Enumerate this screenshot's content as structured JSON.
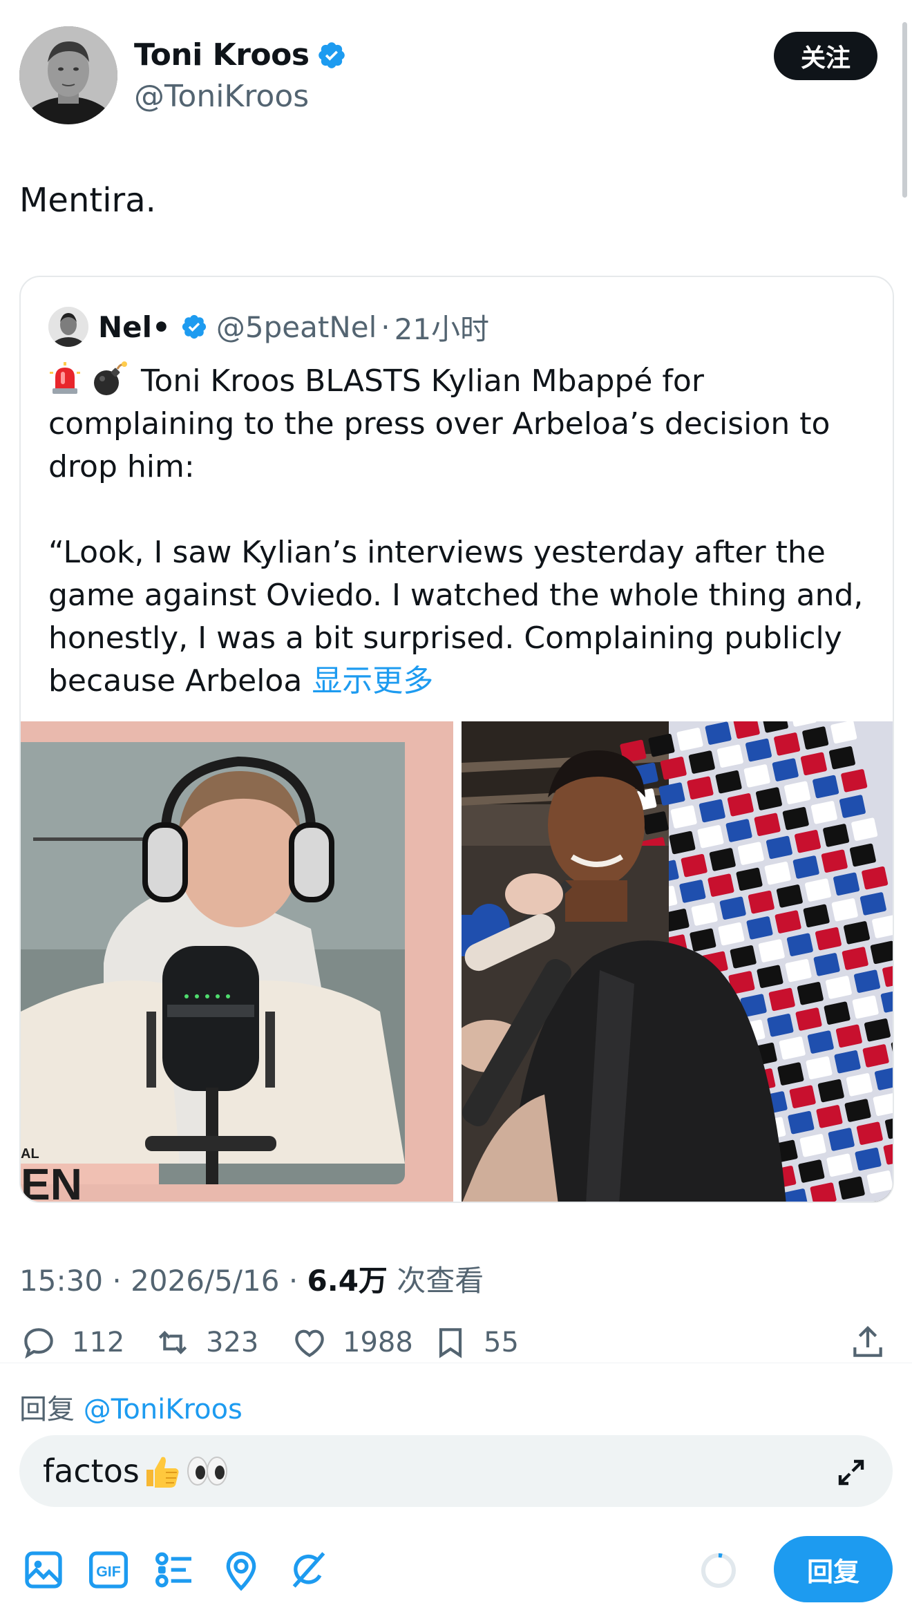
{
  "author": {
    "name": "Toni Kroos",
    "handle": "@ToniKroos",
    "follow_label": "关注"
  },
  "tweet": {
    "text": "Mentira."
  },
  "quote": {
    "name": "Nel•",
    "handle": "@5peatNel",
    "separator": "·",
    "time": "21小时",
    "line1": "Toni Kroos BLASTS Kylian Mbappé for",
    "line2": "complaining to the press over Arbeloa’s decision to",
    "line3": "drop him:",
    "line4": "“Look, I saw Kylian’s interviews yesterday after the",
    "line5": "game against Oviedo. I watched the whole thing and,",
    "line6": "honestly, I was a bit surprised. Complaining publicly",
    "line7": "because Arbeloa ",
    "show_more": "显示更多",
    "media_left_caption": "AL",
    "media_left_caption2": "EN"
  },
  "stats": {
    "time": "15:30",
    "sep": " · ",
    "date": "2026/5/16",
    "sep2": " · ",
    "views": "6.4万",
    "views_label": " 次查看"
  },
  "actions": {
    "replies": "112",
    "reposts": "323",
    "likes": "1988",
    "bookmarks": "55"
  },
  "composer": {
    "reply_to_label": "回复 ",
    "reply_to_mention": "@ToniKroos",
    "input_text": "factos",
    "reply_button": "回复"
  },
  "icons": {
    "verified": "verified-badge-icon",
    "toolbar": [
      "image-icon",
      "gif-icon",
      "poll-icon",
      "location-icon",
      "grok-icon"
    ]
  },
  "colors": {
    "accent": "#1d9bf0",
    "text": "#0f1419",
    "muted": "#536471"
  }
}
